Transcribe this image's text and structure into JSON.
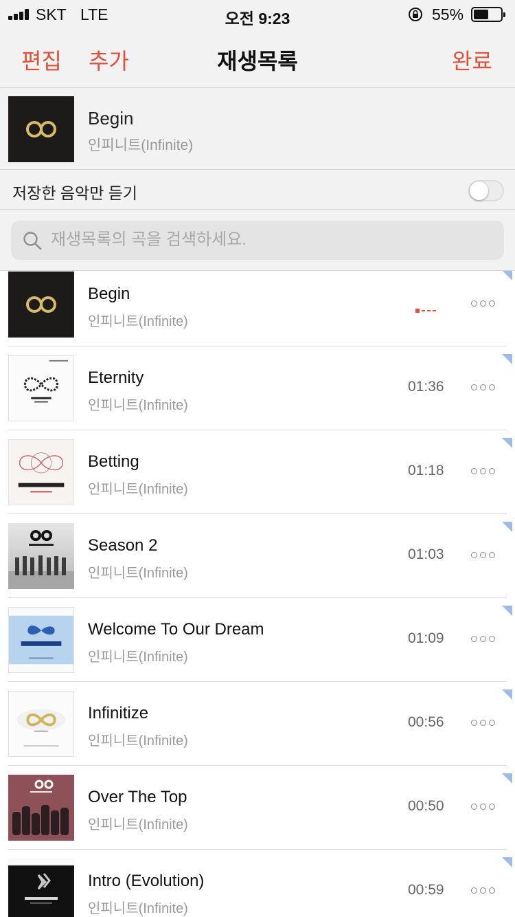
{
  "status_bar": {
    "carrier": "SKT",
    "network": "LTE",
    "time": "오전 9:23",
    "battery_percent": "55%",
    "battery_level": 0.55
  },
  "nav": {
    "edit_label": "편집",
    "add_label": "추가",
    "title": "재생목록",
    "done_label": "완료",
    "accent_color": "#e0503a"
  },
  "now_playing": {
    "title": "Begin",
    "artist": "인피니트(Infinite)"
  },
  "saved_only": {
    "label": "저장한 음악만 듣기",
    "on": false
  },
  "search": {
    "placeholder": "재생목록의 곡을 검색하세요.",
    "value": ""
  },
  "tracks": [
    {
      "title": "Begin",
      "artist": "인피니트(Infinite)",
      "duration": "",
      "playing": true
    },
    {
      "title": "Eternity",
      "artist": "인피니트(Infinite)",
      "duration": "01:36"
    },
    {
      "title": "Betting",
      "artist": "인피니트(Infinite)",
      "duration": "01:18"
    },
    {
      "title": "Season 2",
      "artist": "인피니트(Infinite)",
      "duration": "01:03"
    },
    {
      "title": "Welcome To Our Dream",
      "artist": "인피니트(Infinite)",
      "duration": "01:09"
    },
    {
      "title": "Infinitize",
      "artist": "인피니트(Infinite)",
      "duration": "00:56"
    },
    {
      "title": "Over The Top",
      "artist": "인피니트(Infinite)",
      "duration": "00:50"
    },
    {
      "title": "Intro (Evolution)",
      "artist": "인피니트(Infinite)",
      "duration": "00:59"
    }
  ],
  "icons": {
    "more": "more-dots-icon",
    "search": "search-icon",
    "playing": "equalizer-icon",
    "rotation_lock": "rotation-lock-icon"
  }
}
